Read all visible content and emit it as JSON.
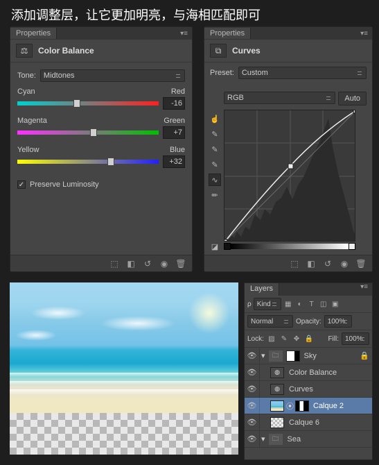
{
  "heading": "添加调整层，让它更加明亮，与海相匹配即可",
  "colorBalance": {
    "panelTab": "Properties",
    "title": "Color Balance",
    "toneLabel": "Tone:",
    "toneValue": "Midtones",
    "sliders": [
      {
        "left": "Cyan",
        "right": "Red",
        "value": "-16",
        "handlePct": 42
      },
      {
        "left": "Magenta",
        "right": "Green",
        "value": "+7",
        "handlePct": 54
      },
      {
        "left": "Yellow",
        "right": "Blue",
        "value": "+32",
        "handlePct": 66
      }
    ],
    "preserveLabel": "Preserve Luminosity",
    "preserveChecked": true
  },
  "curves": {
    "panelTab": "Properties",
    "title": "Curves",
    "presetLabel": "Preset:",
    "presetValue": "Custom",
    "channelValue": "RGB",
    "autoBtn": "Auto"
  },
  "layers": {
    "tab": "Layers",
    "filterLabel": "Kind",
    "blendMode": "Normal",
    "opacityLabel": "Opacity:",
    "opacityValue": "100%",
    "lockLabel": "Lock:",
    "fillLabel": "Fill:",
    "fillValue": "100%",
    "items": [
      {
        "name": "Sky",
        "type": "group",
        "indent": 0,
        "locked": true
      },
      {
        "name": "Color Balance",
        "type": "adjust",
        "indent": 1
      },
      {
        "name": "Curves",
        "type": "adjust",
        "indent": 1
      },
      {
        "name": "Calque 2",
        "type": "image-mask",
        "indent": 1,
        "selected": true
      },
      {
        "name": "Calque 6",
        "type": "checker",
        "indent": 1
      },
      {
        "name": "Sea",
        "type": "group",
        "indent": 0
      }
    ]
  },
  "footerIconsLeft": [
    "⇆",
    "□",
    "⊘",
    "◉",
    "⌦"
  ],
  "footerIconsRight": [
    "⇆",
    "□",
    "⊘",
    "◉",
    "⌦"
  ]
}
